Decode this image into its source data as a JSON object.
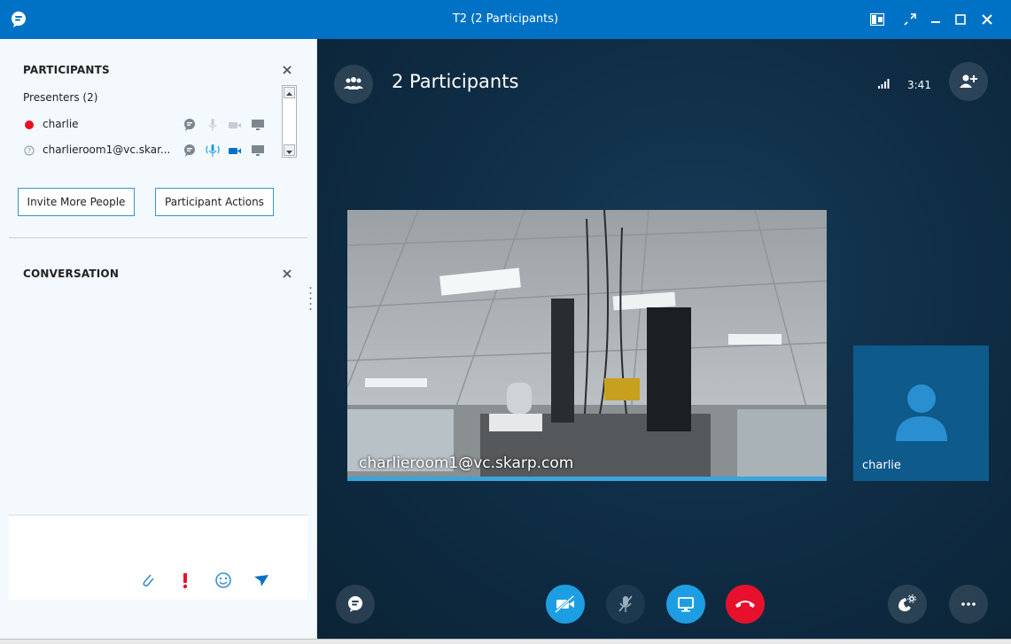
{
  "window": {
    "title": "T2 (2 Participants)"
  },
  "participants_panel": {
    "title": "PARTICIPANTS",
    "group_label": "Presenters (2)",
    "participants": [
      {
        "name": "charlie",
        "status": "busy"
      },
      {
        "name": "charlieroom1@vc.skar...",
        "status": "unknown"
      }
    ],
    "invite_button": "Invite More People",
    "actions_button": "Participant Actions"
  },
  "conversation_panel": {
    "title": "CONVERSATION"
  },
  "stage": {
    "participant_count_label": "2 Participants",
    "call_duration": "3:41",
    "main_video_label": "charlieroom1@vc.skarp.com",
    "avatar_label": "charlie"
  },
  "colors": {
    "brand_blue": "#0072c6",
    "accent_blue": "#1e9ee2",
    "hangup_red": "#e8112d",
    "presence_busy": "#e81123",
    "stage_bg": "#0f2d45"
  }
}
